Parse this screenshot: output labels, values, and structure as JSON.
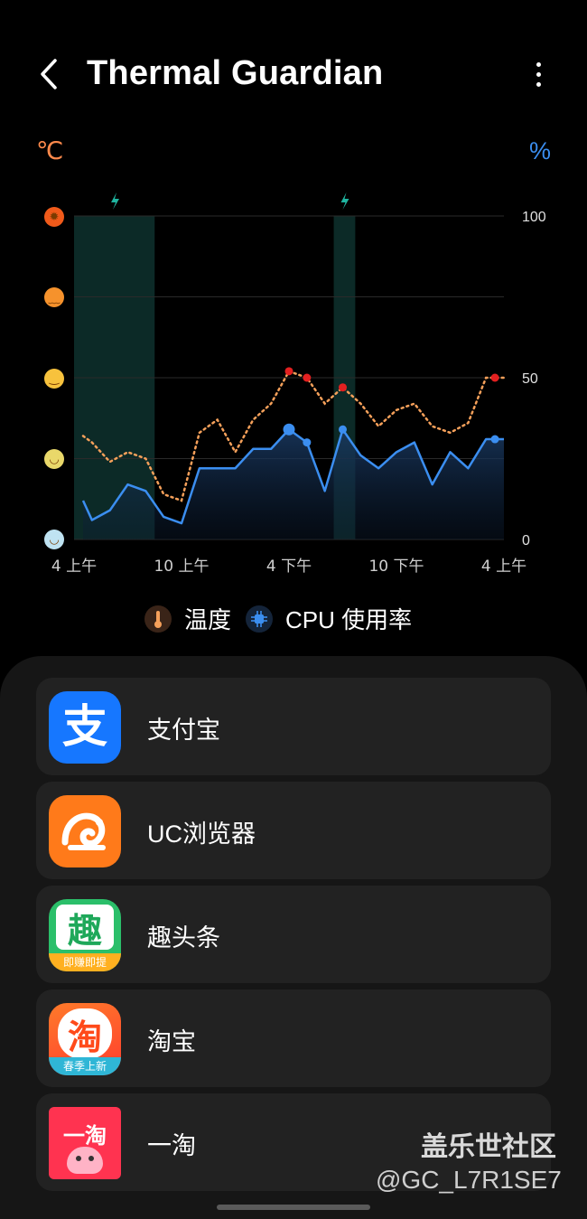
{
  "header": {
    "title": "Thermal Guardian",
    "back_icon": "chevron-left-icon",
    "more_icon": "more-vertical-icon"
  },
  "units": {
    "temperature": "℃",
    "cpu": "%"
  },
  "colors": {
    "temperature": "#f5a05a",
    "temperature_point": "#e32020",
    "cpu": "#3b8ef0",
    "charging": "#1fb5a0",
    "charging_band": "#0c2a27"
  },
  "chart_data": {
    "type": "line",
    "x_tick_labels": [
      "4 上午",
      "10 上午",
      "4 下午",
      "10 下午",
      "4 上午"
    ],
    "x_ticks_hours": [
      0,
      6,
      12,
      18,
      24
    ],
    "y_right_ticks": [
      0,
      50,
      100
    ],
    "ylim": [
      0,
      100
    ],
    "left_axis_icons": [
      "very-hot-face-icon",
      "hot-face-icon",
      "warm-face-icon",
      "normal-face-icon",
      "cool-face-icon"
    ],
    "charging_periods_hours": [
      [
        0,
        4.5
      ],
      [
        14.5,
        15.7
      ]
    ],
    "series": [
      {
        "name": "温度",
        "style": "dotted",
        "x": [
          0,
          1,
          2,
          3,
          4,
          5,
          6,
          7,
          8,
          9,
          10,
          11,
          12,
          13,
          14,
          15,
          16,
          17,
          18,
          19,
          20,
          21,
          22,
          23,
          24
        ],
        "y": [
          32,
          30,
          24,
          27,
          25,
          14,
          12,
          33,
          37,
          27,
          37,
          42,
          52,
          50,
          42,
          47,
          42,
          35,
          40,
          42,
          35,
          33,
          36,
          50,
          50
        ]
      },
      {
        "name": "CPU 使用率",
        "style": "solid-area",
        "x": [
          0,
          1,
          2,
          3,
          4,
          5,
          6,
          7,
          8,
          9,
          10,
          11,
          12,
          13,
          14,
          15,
          16,
          17,
          18,
          19,
          20,
          21,
          22,
          23,
          24
        ],
        "y": [
          12,
          6,
          9,
          17,
          15,
          7,
          5,
          22,
          22,
          22,
          28,
          28,
          34,
          30,
          15,
          34,
          26,
          22,
          27,
          30,
          17,
          27,
          22,
          31,
          31
        ]
      }
    ],
    "highlighted_points": {
      "temperature_x": [
        12,
        13,
        15,
        23.5
      ],
      "cpu_x": [
        12,
        13,
        15,
        23.5
      ]
    }
  },
  "legend": [
    {
      "label": "温度",
      "icon": "thermometer-icon"
    },
    {
      "label": "CPU 使用率",
      "icon": "cpu-chip-icon"
    }
  ],
  "apps": [
    {
      "name": "支付宝",
      "icon": "alipay-app-icon"
    },
    {
      "name": "UC浏览器",
      "icon": "uc-browser-app-icon"
    },
    {
      "name": "趣头条",
      "icon": "qutoutiao-app-icon",
      "icon_text": "趣",
      "icon_subtext": "即赚即提"
    },
    {
      "name": "淘宝",
      "icon": "taobao-app-icon",
      "icon_text": "淘",
      "icon_subtext": "春季上新"
    },
    {
      "name": "一淘",
      "icon": "yitao-app-icon",
      "icon_text": "一淘"
    }
  ],
  "watermark": {
    "line1": "盖乐世社区",
    "line2": "@GC_L7R1SE7"
  }
}
